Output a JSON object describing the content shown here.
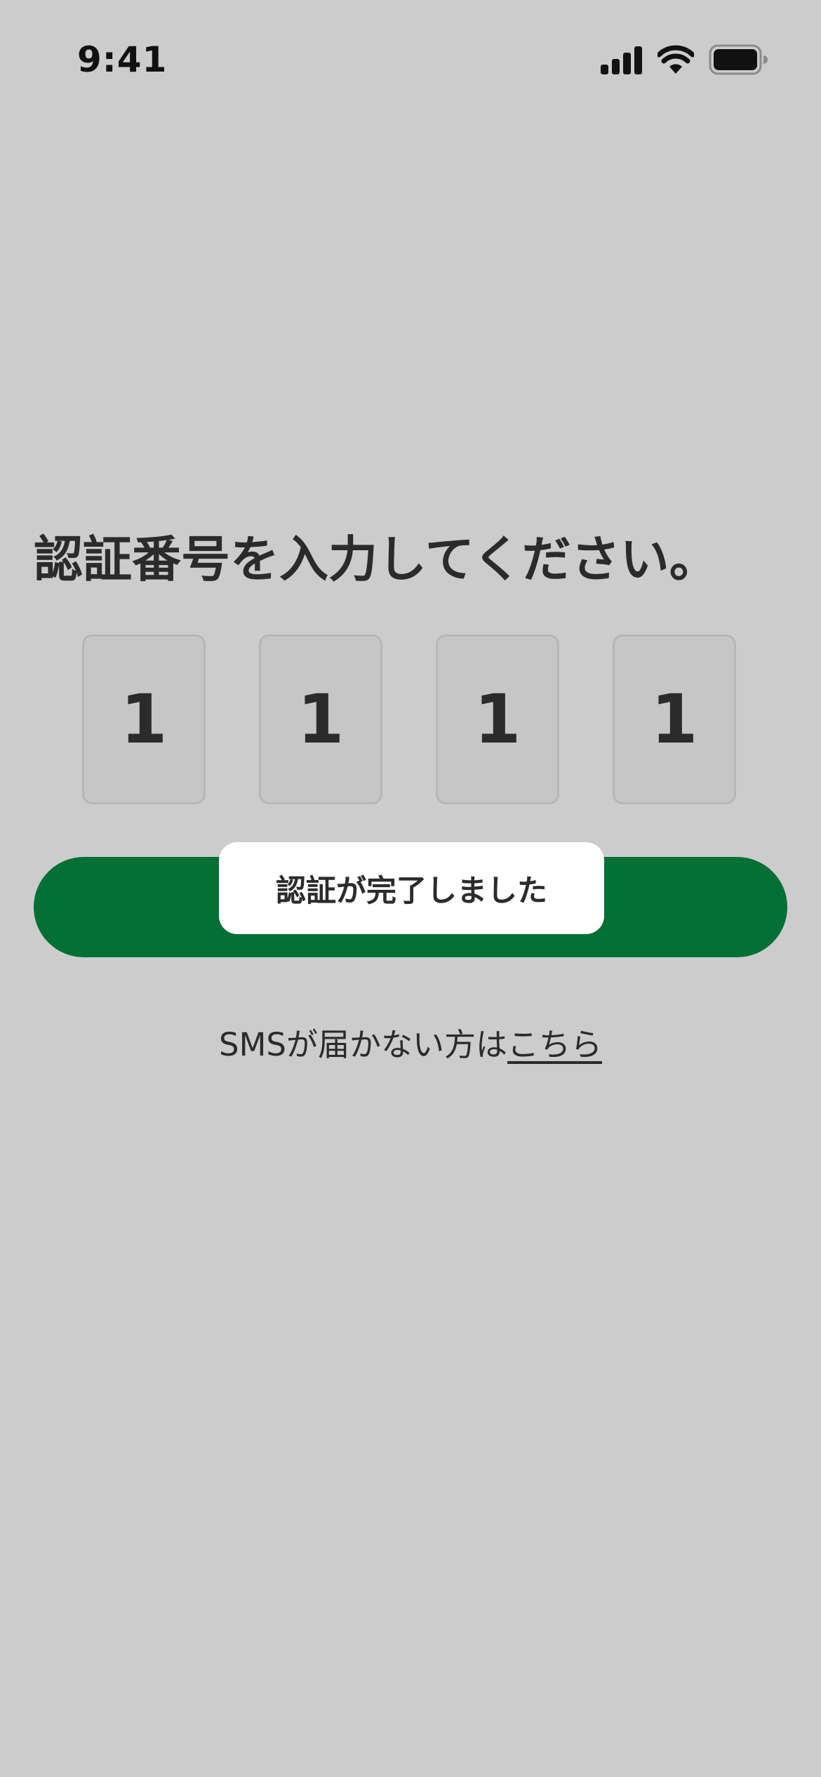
{
  "status_bar": {
    "time": "9:41",
    "icons": [
      "signal-icon",
      "wifi-icon",
      "battery-icon"
    ]
  },
  "title": "認証番号を入力してください。",
  "code": {
    "digits": [
      "1",
      "1",
      "1",
      "1"
    ]
  },
  "toast": {
    "message": "認証が完了しました"
  },
  "sms_help": {
    "text": "SMSが届かない方は",
    "link_label": "こちら"
  },
  "colors": {
    "background": "#cccccc",
    "button": "#026f35",
    "toast_background": "#ffffff",
    "text": "#2b2b2b"
  }
}
